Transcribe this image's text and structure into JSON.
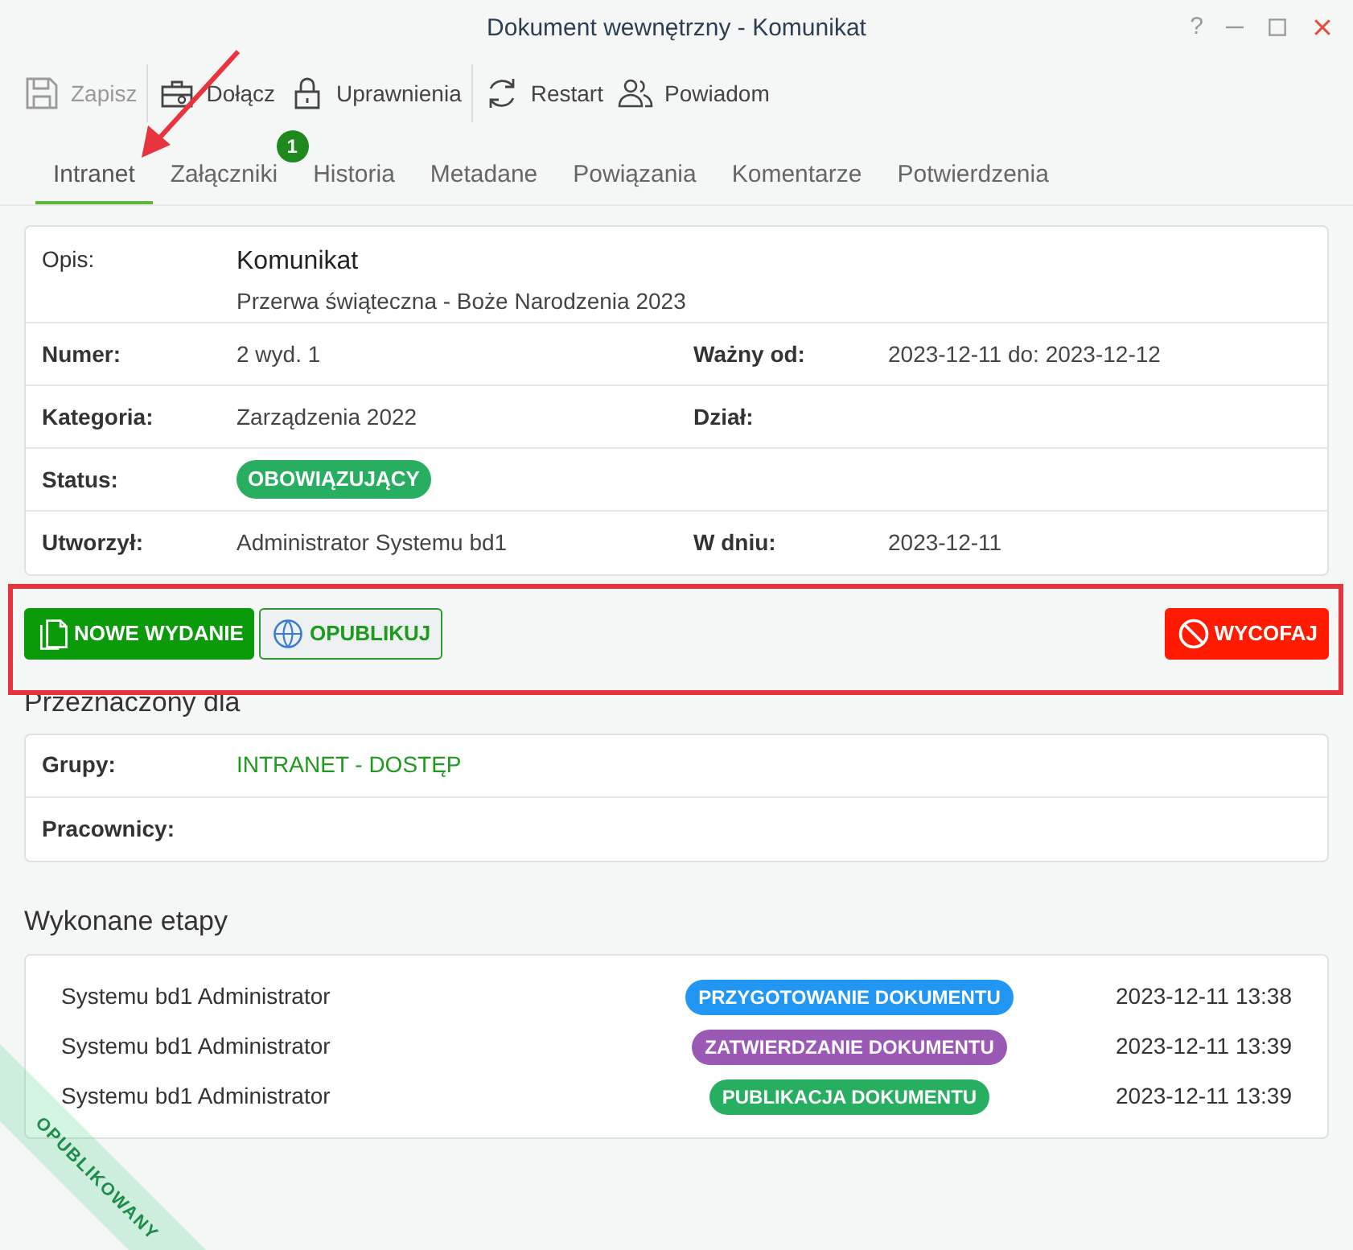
{
  "window": {
    "title": "Dokument wewnętrzny - Komunikat",
    "controls": [
      "?"
    ]
  },
  "toolbar": [
    {
      "label": "Zapisz",
      "kind": "save",
      "disabled": true
    },
    {
      "label": "Dołącz",
      "kind": "attach",
      "disabled": false
    },
    {
      "label": "Uprawnienia",
      "kind": "permissions",
      "disabled": false
    },
    {
      "label": "Restart",
      "kind": "restart",
      "disabled": false
    },
    {
      "label": "Powiadom",
      "kind": "notify",
      "disabled": false
    }
  ],
  "tabs": [
    {
      "label": "Intranet",
      "selected": true
    },
    {
      "label": "Załączniki",
      "selected": false,
      "badge": "1"
    },
    {
      "label": "Historia",
      "selected": false
    },
    {
      "label": "Metadane",
      "selected": false
    },
    {
      "label": "Powiązania",
      "selected": false
    },
    {
      "label": "Komentarze",
      "selected": false
    },
    {
      "label": "Potwierdzenia",
      "selected": false
    }
  ],
  "details": {
    "description": {
      "label": "Opis:",
      "title": "Komunikat",
      "text": "Przerwa świąteczna - Boże Narodzenia 2023"
    },
    "rows": [
      [
        {
          "label": "Numer:",
          "value": "2 wyd. 1"
        },
        {
          "label": "Ważny od:",
          "value": "2023-12-11 do: 2023-12-12"
        }
      ],
      [
        {
          "label": "Kategoria:",
          "value": "Zarządzenia 2022"
        },
        {
          "label": "Dział:"
        }
      ],
      [
        {
          "label": "Status:",
          "badge": "OBOWIĄZUJĄCY"
        }
      ],
      [
        {
          "label": "Utworzył:",
          "value": "Administrator Systemu bd1"
        },
        {
          "label": "W dniu:",
          "value": "2023-12-11"
        }
      ]
    ]
  },
  "actions": [
    {
      "label": "NOWE WYDANIE",
      "kind": "primary"
    },
    {
      "label": "OPUBLIKUJ",
      "kind": "outline"
    },
    {
      "label": "WYCOFAJ",
      "kind": "danger"
    }
  ],
  "audience": {
    "title": "Przeznaczony dla",
    "rows": [
      {
        "label": "Grupy:",
        "value": "INTRANET - DOSTĘP"
      },
      {
        "label": "Pracownicy:"
      }
    ]
  },
  "stages": {
    "title": "Wykonane etapy",
    "rows": [
      {
        "user": "Systemu bd1 Administrator",
        "stage": "PRZYGOTOWANIE DOKUMENTU",
        "color": "#2196f3",
        "time": "2023-12-11 13:38"
      },
      {
        "user": "Systemu bd1 Administrator",
        "stage": "ZATWIERDZANIE DOKUMENTU",
        "color": "#9b59b6",
        "time": "2023-12-11 13:39"
      },
      {
        "user": "Systemu bd1 Administrator",
        "stage": "PUBLIKACJA DOKUMENTU",
        "color": "#27ae60",
        "time": "2023-12-11 13:39"
      }
    ]
  },
  "ribbon": "OPUBLIKOWANY"
}
